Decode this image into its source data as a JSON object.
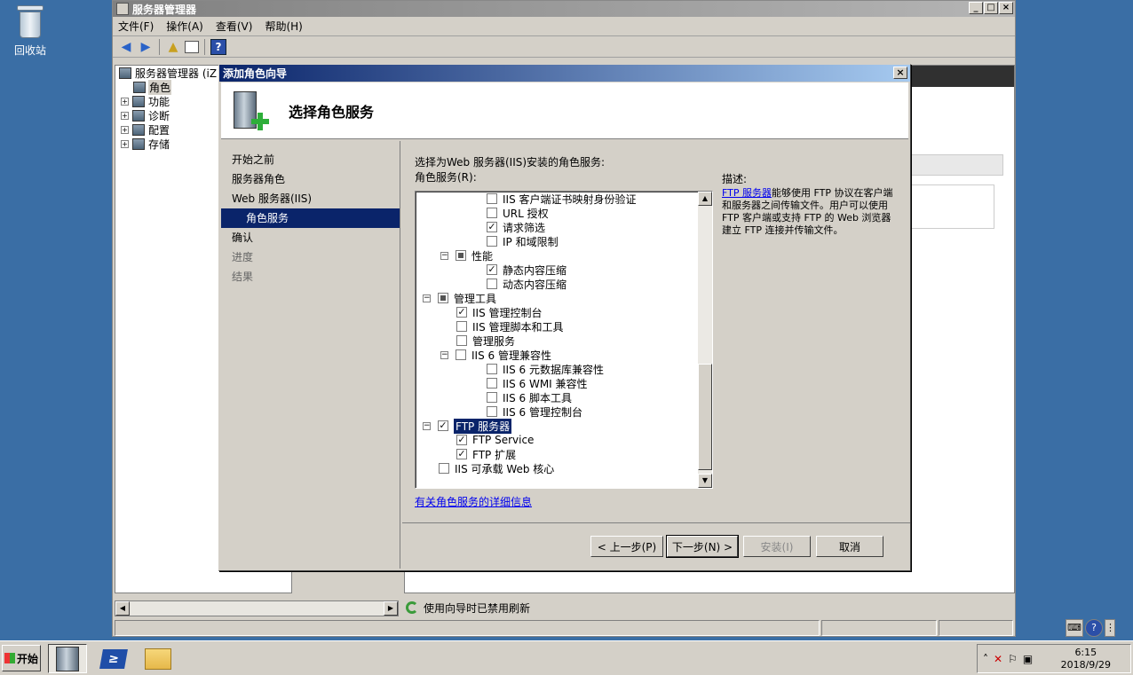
{
  "desktop": {
    "recycle_label": "回收站"
  },
  "main_window": {
    "title": "服务器管理器",
    "controls": {
      "minimize": "_",
      "maximize": "□",
      "close": "×"
    },
    "menu": [
      "文件(F)",
      "操作(A)",
      "查看(V)",
      "帮助(H)"
    ],
    "tree": {
      "root": "服务器管理器 (iZ",
      "items": [
        "角色",
        "功能",
        "诊断",
        "配置",
        "存储"
      ]
    },
    "status_message": "使用向导时已禁用刷新"
  },
  "wizard": {
    "title": "添加角色向导",
    "close": "×",
    "heading": "选择角色服务",
    "steps": [
      "开始之前",
      "服务器角色",
      "Web 服务器(IIS)",
      "角色服务",
      "确认",
      "进度",
      "结果"
    ],
    "instruction": "选择为Web 服务器(IIS)安装的角色服务:",
    "role_services_label": "角色服务(R):",
    "role_services": [
      {
        "label": "IIS 客户端证书映射身份验证",
        "checked": "",
        "level": 3
      },
      {
        "label": "URL 授权",
        "checked": "",
        "level": 3
      },
      {
        "label": "请求筛选",
        "checked": "✓",
        "level": 3
      },
      {
        "label": "IP 和域限制",
        "checked": "",
        "level": 3
      },
      {
        "label": "性能",
        "checked": "",
        "level": 2,
        "expander": "−",
        "partial": true
      },
      {
        "label": "静态内容压缩",
        "checked": "✓",
        "level": 3
      },
      {
        "label": "动态内容压缩",
        "checked": "",
        "level": 3
      },
      {
        "label": "管理工具",
        "checked": "",
        "level": 1,
        "expander": "−",
        "partial": true
      },
      {
        "label": "IIS 管理控制台",
        "checked": "✓",
        "level": 2
      },
      {
        "label": "IIS 管理脚本和工具",
        "checked": "",
        "level": 2
      },
      {
        "label": "管理服务",
        "checked": "",
        "level": 2
      },
      {
        "label": "IIS 6 管理兼容性",
        "checked": "",
        "level": 2,
        "expander": "−"
      },
      {
        "label": "IIS 6 元数据库兼容性",
        "checked": "",
        "level": 3
      },
      {
        "label": "IIS 6 WMI 兼容性",
        "checked": "",
        "level": 3
      },
      {
        "label": "IIS 6 脚本工具",
        "checked": "",
        "level": 3
      },
      {
        "label": "IIS 6 管理控制台",
        "checked": "",
        "level": 3
      },
      {
        "label": "FTP 服务器",
        "checked": "✓",
        "level": 1,
        "expander": "−",
        "highlight": true
      },
      {
        "label": "FTP Service",
        "checked": "✓",
        "level": 2
      },
      {
        "label": "FTP 扩展",
        "checked": "✓",
        "level": 2
      },
      {
        "label": "IIS 可承载 Web 核心",
        "checked": "",
        "level": 1
      }
    ],
    "description_label": "描述:",
    "description_link": "FTP 服务器",
    "description_text": "能够使用 FTP 协议在客户端和服务器之间传输文件。用户可以使用 FTP 客户端或支持 FTP 的 Web 浏览器建立 FTP 连接并传输文件。",
    "more_info_link": "有关角色服务的详细信息",
    "buttons": {
      "back": "< 上一步(P)",
      "next": "下一步(N) >",
      "install": "安装(I)",
      "cancel": "取消"
    }
  },
  "taskbar": {
    "start": "开始",
    "clock_time": "6:15",
    "clock_date": "2018/9/29"
  }
}
